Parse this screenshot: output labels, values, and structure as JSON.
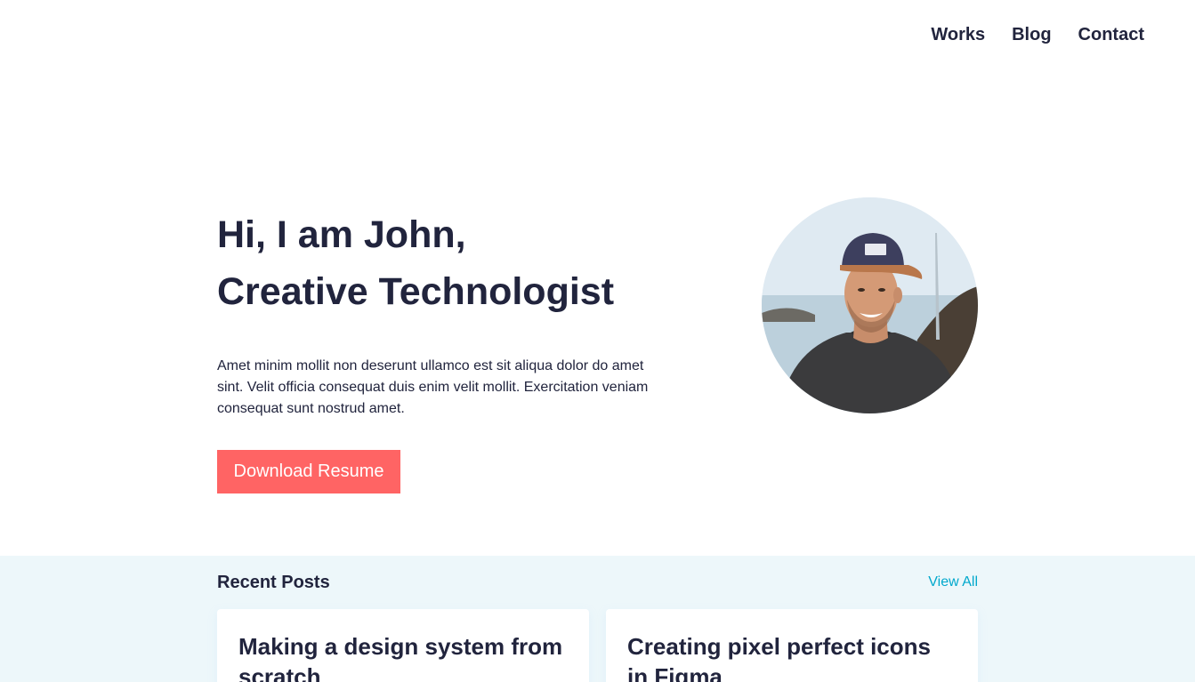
{
  "nav": {
    "items": [
      {
        "label": "Works"
      },
      {
        "label": "Blog"
      },
      {
        "label": "Contact"
      }
    ]
  },
  "hero": {
    "title_line1": "Hi, I am John,",
    "title_line2": "Creative Technologist",
    "description": "Amet minim mollit non deserunt ullamco est sit aliqua dolor do amet sint. Velit officia consequat duis enim velit mollit. Exercitation veniam consequat sunt nostrud amet.",
    "button_label": "Download Resume"
  },
  "recent_posts": {
    "heading": "Recent Posts",
    "view_all_label": "View All",
    "posts": [
      {
        "title": "Making a design system from scratch"
      },
      {
        "title": "Creating pixel perfect icons in Figma"
      }
    ]
  },
  "colors": {
    "text": "#21243d",
    "accent": "#ff6464",
    "link": "#00a8cc",
    "section_bg": "#edf7fa"
  }
}
